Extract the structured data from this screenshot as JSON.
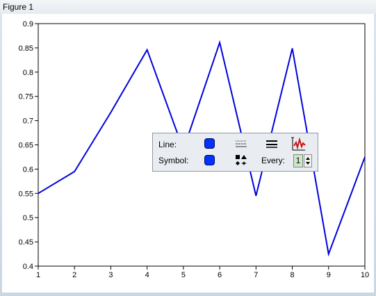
{
  "window": {
    "title": "Figure 1"
  },
  "colors": {
    "line": "#0000dd",
    "axes": "#000000",
    "background": "#ffffff",
    "swatch": "#0033ff"
  },
  "chart_data": {
    "type": "line",
    "x": [
      1,
      2,
      3,
      4,
      5,
      6,
      7,
      8,
      9,
      10
    ],
    "series": [
      {
        "values": [
          0.55,
          0.595,
          0.717,
          0.846,
          0.64,
          0.861,
          0.545,
          0.849,
          0.425,
          0.625
        ]
      }
    ],
    "xlim": [
      1,
      10
    ],
    "ylim": [
      0.4,
      0.9
    ],
    "xticks": [
      "1",
      "2",
      "3",
      "4",
      "5",
      "6",
      "7",
      "8",
      "9",
      "10"
    ],
    "yticks": [
      "0.4",
      "0.45",
      "0.5",
      "0.55",
      "0.6",
      "0.65",
      "0.7",
      "0.75",
      "0.8",
      "0.85",
      "0.9"
    ],
    "grid": false
  },
  "plot_toolbar": {
    "line_label": "Line:",
    "symbol_label": "Symbol:",
    "every_label": "Every:",
    "every_value": "1",
    "icons": [
      "line-color-icon",
      "line-style-icon",
      "line-width-icon",
      "data-cursor-icon",
      "symbol-color-icon",
      "symbol-shape-icon"
    ]
  }
}
